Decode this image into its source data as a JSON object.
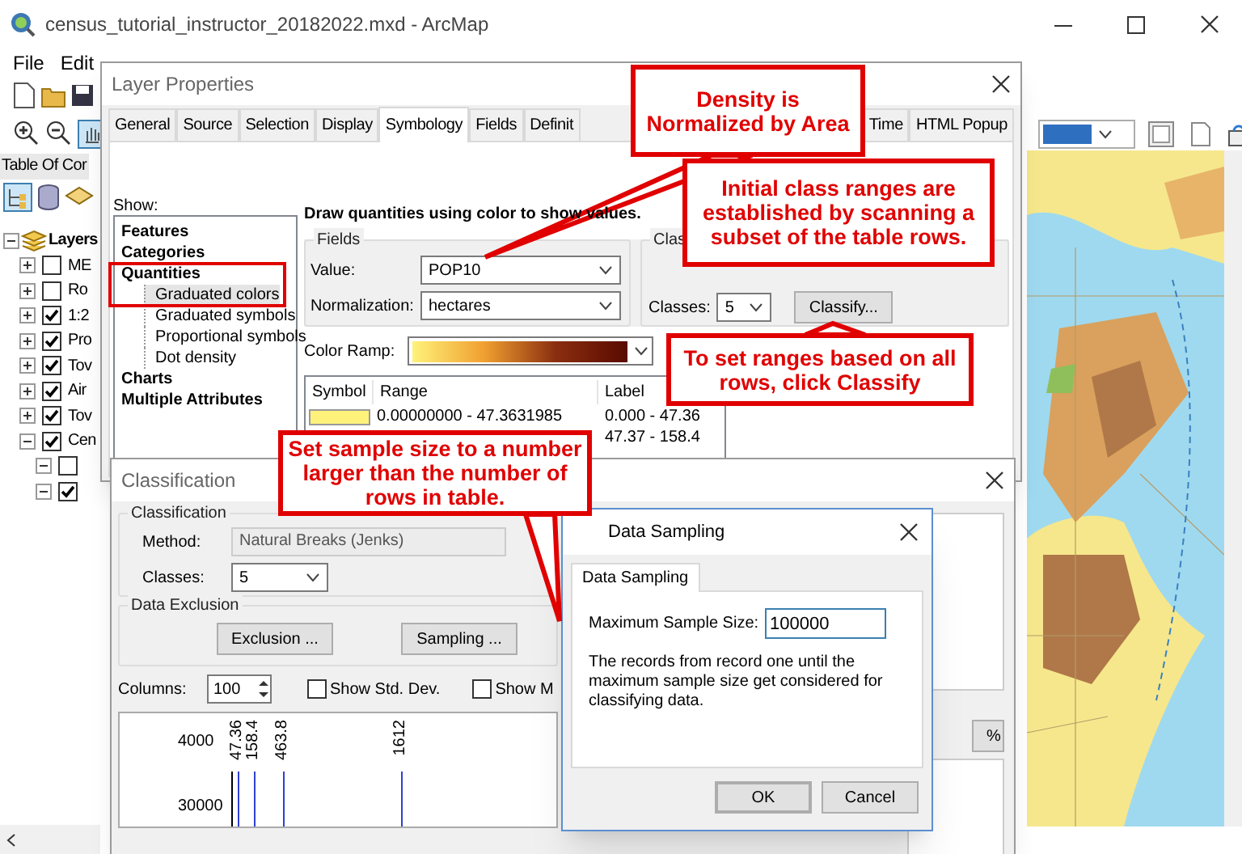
{
  "app_window": {
    "title": "census_tutorial_instructor_20182022.mxd - ArcMap",
    "menu": [
      "File",
      "Edit"
    ]
  },
  "toc": {
    "title": "Table Of Cor",
    "tree": [
      {
        "label": "Layers",
        "expanded": true,
        "kind": "root",
        "children": [
          {
            "label": "ME",
            "checked": false,
            "expanded": false
          },
          {
            "label": "Ro",
            "checked": false,
            "expanded": false
          },
          {
            "label": "1:2",
            "checked": true,
            "expanded": false
          },
          {
            "label": "Pro",
            "checked": true,
            "expanded": false
          },
          {
            "label": "Tov",
            "checked": true,
            "expanded": false
          },
          {
            "label": "Air",
            "checked": true,
            "expanded": false
          },
          {
            "label": "Tov",
            "checked": true,
            "expanded": false
          },
          {
            "label": "Cen",
            "checked": true,
            "expanded": true,
            "children": [
              {
                "checked": false,
                "expanded": true
              },
              {
                "checked": true,
                "expanded": true
              }
            ]
          }
        ]
      }
    ]
  },
  "layer_properties": {
    "title": "Layer Properties",
    "tabs": [
      {
        "label": "General",
        "selected": false,
        "kind": "tab"
      },
      {
        "label": "Source",
        "selected": false,
        "kind": "tab"
      },
      {
        "label": "Selection",
        "selected": false,
        "kind": "tab"
      },
      {
        "label": "Display",
        "selected": false,
        "kind": "tab"
      },
      {
        "label": "Symbology",
        "selected": true,
        "kind": "tab"
      },
      {
        "label": "Fields",
        "selected": false,
        "kind": "tab"
      },
      {
        "label": "Definit",
        "selected": false,
        "kind": "clipped"
      },
      {
        "label": "Time",
        "selected": false,
        "kind": "tab"
      },
      {
        "label": "HTML Popup",
        "selected": false,
        "kind": "tab"
      }
    ],
    "show_label": "Show:",
    "show_list": [
      {
        "label": "Features",
        "kind": "category"
      },
      {
        "label": "Categories",
        "kind": "category"
      },
      {
        "label": "Quantities",
        "kind": "category"
      },
      {
        "label": "Graduated colors",
        "kind": "sub",
        "selected": true
      },
      {
        "label": "Graduated symbols",
        "kind": "sub",
        "selected": false
      },
      {
        "label": "Proportional symbols",
        "kind": "sub",
        "selected": false
      },
      {
        "label": "Dot density",
        "kind": "sub",
        "selected": false
      },
      {
        "label": "Charts",
        "kind": "category"
      },
      {
        "label": "Multiple Attributes",
        "kind": "category"
      }
    ],
    "heading": "Draw quantities using color to show values.",
    "fields": {
      "title": "Fields",
      "value_label": "Value:",
      "value": "POP10",
      "normalization_label": "Normalization:",
      "normalization": "hectares"
    },
    "classification": {
      "title": "Clas",
      "classes_label": "Classes:",
      "classes": "5",
      "classify_button": "Classify..."
    },
    "color_ramp_label": "Color Ramp:",
    "symbol_table": {
      "columns": [
        "Symbol",
        "Range",
        "Label"
      ],
      "rows": [
        {
          "color": "#fff27a",
          "range": "0.00000000 - 47.3631985",
          "label": "0.000 - 47.36"
        },
        {
          "label": "47.37 - 158.4"
        }
      ]
    }
  },
  "classification_window": {
    "title": "Classification",
    "group_title": "Classification",
    "method_label": "Method:",
    "method": "Natural Breaks (Jenks)",
    "classes_label": "Classes:",
    "classes": "5",
    "exclusion_title": "Data Exclusion",
    "buttons": [
      "Exclusion ...",
      "Sampling ..."
    ],
    "columns_label": "Columns:",
    "columns": "100",
    "checkboxes": [
      {
        "label": "Show Std. Dev.",
        "checked": false
      },
      {
        "label": "Show M",
        "checked": false
      }
    ],
    "percent_button": "%",
    "histogram": {
      "y_labels": [
        "4000",
        "30000"
      ],
      "break_labels": [
        "47.36",
        "158.4",
        "463.8",
        "1612"
      ]
    }
  },
  "data_sampling": {
    "title": "Data Sampling",
    "tab": "Data Sampling",
    "size_label": "Maximum Sample Size:",
    "size": "100000",
    "description": "The records from record one until the maximum sample size get considered for classifying data.",
    "buttons": [
      {
        "label": "OK",
        "default": true
      },
      {
        "label": "Cancel",
        "default": false
      }
    ]
  },
  "callouts": [
    {
      "text": "Density is Normalized by Area"
    },
    {
      "text": "Initial class ranges are established by scanning a subset of the table rows."
    },
    {
      "text": "To set ranges based on all rows, click Classify"
    },
    {
      "text": "Set sample size to a number larger than the number of rows in table."
    }
  ]
}
